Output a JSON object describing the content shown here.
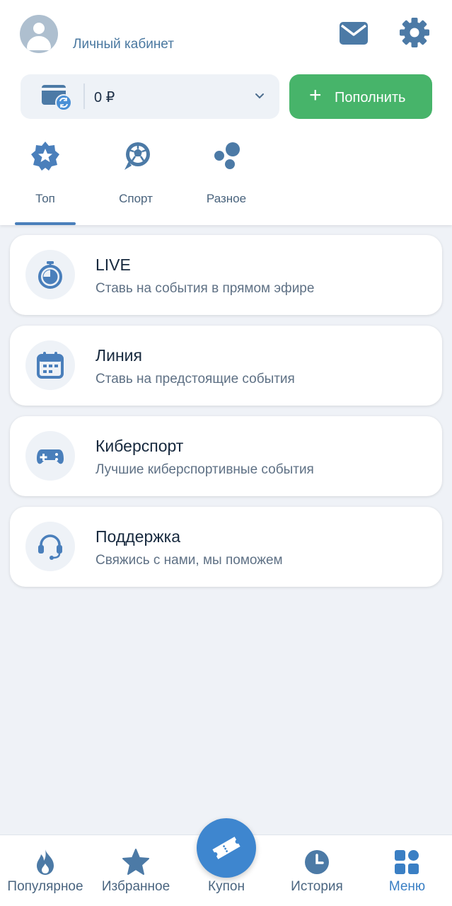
{
  "header": {
    "account_label": "Личный кабинет",
    "balance": "0 ₽",
    "topup_label": "Пополнить"
  },
  "categories": [
    {
      "label": "Топ",
      "icon": "star-badge-icon",
      "active": true
    },
    {
      "label": "Спорт",
      "icon": "soccer-ball-icon",
      "active": false
    },
    {
      "label": "Разное",
      "icon": "bubbles-icon",
      "active": false
    }
  ],
  "cards": [
    {
      "title": "LIVE",
      "subtitle": "Ставь на события в прямом эфире",
      "icon": "stopwatch-icon"
    },
    {
      "title": "Линия",
      "subtitle": "Ставь на предстоящие события",
      "icon": "calendar-icon"
    },
    {
      "title": "Киберспорт",
      "subtitle": "Лучшие киберспортивные события",
      "icon": "gamepad-icon"
    },
    {
      "title": "Поддержка",
      "subtitle": "Свяжись с нами, мы поможем",
      "icon": "headset-icon"
    }
  ],
  "bottom_nav": [
    {
      "label": "Популярное",
      "icon": "flame-icon"
    },
    {
      "label": "Избранное",
      "icon": "star-icon"
    },
    {
      "label": "Купон",
      "icon": "ticket-icon"
    },
    {
      "label": "История",
      "icon": "clock-icon"
    },
    {
      "label": "Меню",
      "icon": "grid-icon",
      "active": true
    }
  ],
  "colors": {
    "accent": "#3a7fc4",
    "topup_green": "#47b46a",
    "icon_blue": "#4a7fbb",
    "background": "#eff2f7"
  }
}
